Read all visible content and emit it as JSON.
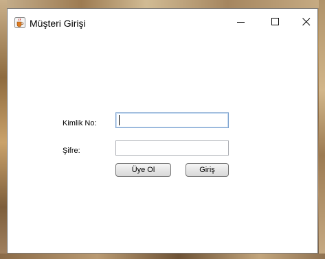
{
  "window": {
    "title": "Müşteri Girişi",
    "icon": "java-cup-icon",
    "controls": {
      "minimize": "minimize-icon",
      "maximize": "maximize-icon",
      "close": "close-icon"
    }
  },
  "form": {
    "id_label": "Kimlik No:",
    "id_value": "",
    "password_label": "Şifre:",
    "password_value": "",
    "register_button": "Üye Ol",
    "login_button": "Giriş"
  },
  "colors": {
    "focus_border": "#7da2ce",
    "field_border": "#abadb3",
    "button_border": "#707070"
  }
}
